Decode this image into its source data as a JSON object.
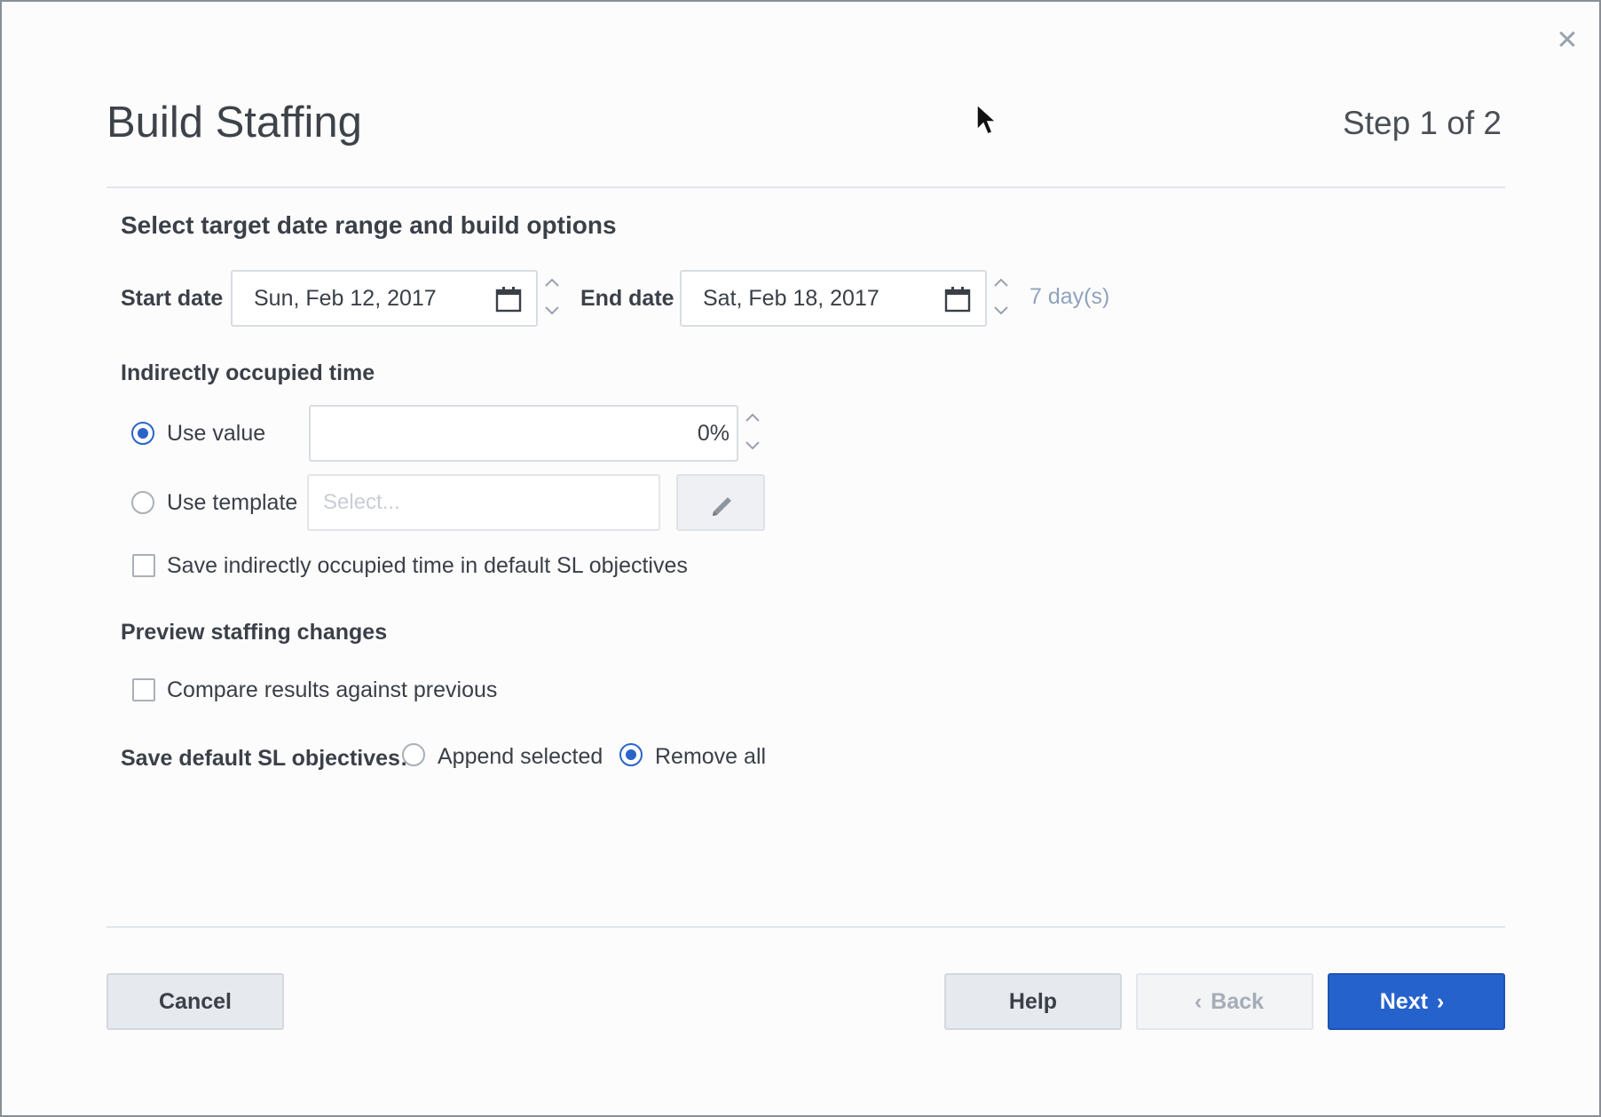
{
  "dialog": {
    "title": "Build Staffing",
    "step": "Step 1 of 2",
    "close_icon": "close-icon"
  },
  "date_range": {
    "section_title": "Select target date range and build options",
    "start_label": "Start date",
    "start_value": "Sun, Feb 12, 2017",
    "end_label": "End date",
    "end_value": "Sat, Feb 18, 2017",
    "duration": "7 day(s)"
  },
  "indirect_time": {
    "title": "Indirectly occupied time",
    "use_value_label": "Use value",
    "use_value_selected": true,
    "value": "0%",
    "use_template_label": "Use template",
    "template_placeholder": "Select...",
    "save_checkbox_label": "Save indirectly occupied time in default SL objectives",
    "save_checked": false
  },
  "preview": {
    "title": "Preview staffing changes",
    "compare_label": "Compare results against previous",
    "compare_checked": false
  },
  "sl_objectives": {
    "label": "Save default SL objectives:",
    "append_label": "Append selected",
    "remove_label": "Remove all",
    "selected": "Remove all"
  },
  "footer": {
    "cancel": "Cancel",
    "help": "Help",
    "back": "Back",
    "next": "Next"
  },
  "colors": {
    "primary": "#2562cc",
    "muted_text": "#8fa3bb"
  }
}
